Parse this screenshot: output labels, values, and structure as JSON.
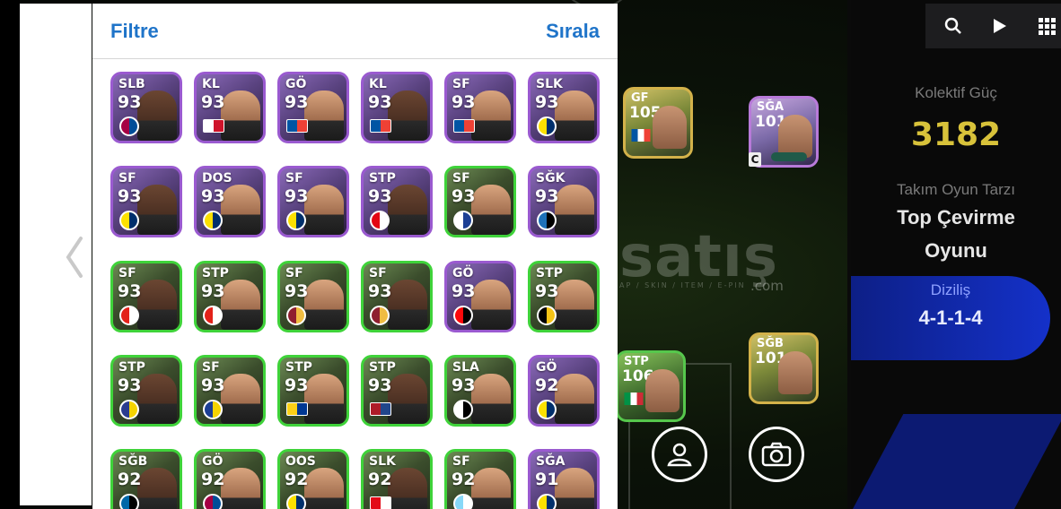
{
  "modal": {
    "filter_label": "Filtre",
    "sort_label": "Sırala"
  },
  "cards": [
    {
      "pos": "SLB",
      "ovr": "93",
      "frame": "purple",
      "emblem": "club-badge",
      "colors": [
        "#a50044",
        "#004d98"
      ]
    },
    {
      "pos": "KL",
      "ovr": "93",
      "frame": "purple",
      "emblem": "flag",
      "colors": [
        "#ffffff",
        "#cf142b"
      ]
    },
    {
      "pos": "GÖ",
      "ovr": "93",
      "frame": "purple",
      "emblem": "flag",
      "colors": [
        "#0055a4",
        "#ef4135"
      ]
    },
    {
      "pos": "KL",
      "ovr": "93",
      "frame": "purple",
      "emblem": "flag",
      "colors": [
        "#0055a4",
        "#ef4135"
      ]
    },
    {
      "pos": "SF",
      "ovr": "93",
      "frame": "purple",
      "emblem": "flag",
      "colors": [
        "#0055a4",
        "#ef4135"
      ]
    },
    {
      "pos": "SLK",
      "ovr": "93",
      "frame": "purple",
      "emblem": "club-badge",
      "colors": [
        "#fde100",
        "#002f6c"
      ]
    },
    {
      "pos": "SF",
      "ovr": "93",
      "frame": "purple",
      "emblem": "club-badge",
      "colors": [
        "#fde100",
        "#002f6c"
      ]
    },
    {
      "pos": "DOS",
      "ovr": "93",
      "frame": "purple",
      "emblem": "club-badge",
      "colors": [
        "#fde100",
        "#002f6c"
      ]
    },
    {
      "pos": "SF",
      "ovr": "93",
      "frame": "purple",
      "emblem": "club-badge",
      "colors": [
        "#fde100",
        "#002f6c"
      ]
    },
    {
      "pos": "STP",
      "ovr": "93",
      "frame": "purple",
      "emblem": "club-badge",
      "colors": [
        "#e30613",
        "#ffffff"
      ]
    },
    {
      "pos": "SF",
      "ovr": "93",
      "frame": "green",
      "emblem": "club-badge",
      "colors": [
        "#ffffff",
        "#1c3f94"
      ]
    },
    {
      "pos": "SĞK",
      "ovr": "93",
      "frame": "purple",
      "emblem": "club-badge",
      "colors": [
        "#1e71b8",
        "#000000"
      ]
    },
    {
      "pos": "SF",
      "ovr": "93",
      "frame": "green",
      "emblem": "club-badge",
      "colors": [
        "#e32219",
        "#ffffff"
      ]
    },
    {
      "pos": "STP",
      "ovr": "93",
      "frame": "green",
      "emblem": "club-badge",
      "colors": [
        "#e32219",
        "#ffffff"
      ]
    },
    {
      "pos": "SF",
      "ovr": "93",
      "frame": "green",
      "emblem": "club-badge",
      "colors": [
        "#8e1f2f",
        "#f0bc42"
      ]
    },
    {
      "pos": "SF",
      "ovr": "93",
      "frame": "green",
      "emblem": "club-badge",
      "colors": [
        "#8e1f2f",
        "#f0bc42"
      ]
    },
    {
      "pos": "GÖ",
      "ovr": "93",
      "frame": "purple",
      "emblem": "club-badge",
      "colors": [
        "#fb090b",
        "#000000"
      ]
    },
    {
      "pos": "STP",
      "ovr": "93",
      "frame": "green",
      "emblem": "club-badge",
      "colors": [
        "#000000",
        "#f3c316"
      ]
    },
    {
      "pos": "STP",
      "ovr": "93",
      "frame": "green",
      "emblem": "club-badge",
      "colors": [
        "#2a3c8f",
        "#f5d400"
      ]
    },
    {
      "pos": "SF",
      "ovr": "93",
      "frame": "green",
      "emblem": "club-badge",
      "colors": [
        "#1c3f94",
        "#f5d400"
      ]
    },
    {
      "pos": "STP",
      "ovr": "93",
      "frame": "green",
      "emblem": "flag",
      "colors": [
        "#fcd116",
        "#003893"
      ]
    },
    {
      "pos": "STP",
      "ovr": "93",
      "frame": "green",
      "emblem": "flag",
      "colors": [
        "#ae1c28",
        "#21468b"
      ]
    },
    {
      "pos": "SLA",
      "ovr": "93",
      "frame": "green",
      "emblem": "club-badge",
      "colors": [
        "#ffffff",
        "#000000"
      ]
    },
    {
      "pos": "GÖ",
      "ovr": "92",
      "frame": "purple",
      "emblem": "club-badge",
      "colors": [
        "#fde100",
        "#002f6c"
      ]
    },
    {
      "pos": "SĞB",
      "ovr": "92",
      "frame": "green",
      "emblem": "club-badge",
      "colors": [
        "#0068a8",
        "#000000"
      ]
    },
    {
      "pos": "GÖ",
      "ovr": "92",
      "frame": "green",
      "emblem": "club-badge",
      "colors": [
        "#a50044",
        "#004d98"
      ]
    },
    {
      "pos": "OOS",
      "ovr": "92",
      "frame": "green",
      "emblem": "club-badge",
      "colors": [
        "#fde100",
        "#002f6c"
      ]
    },
    {
      "pos": "SLK",
      "ovr": "92",
      "frame": "green",
      "emblem": "flag",
      "colors": [
        "#e30a17",
        "#ffffff"
      ]
    },
    {
      "pos": "SF",
      "ovr": "92",
      "frame": "green",
      "emblem": "club-badge",
      "colors": [
        "#87d8f7",
        "#ffffff"
      ]
    },
    {
      "pos": "SĞA",
      "ovr": "91",
      "frame": "purple",
      "emblem": "club-badge",
      "colors": [
        "#fde100",
        "#002f6c"
      ]
    }
  ],
  "field_cards": [
    {
      "pos": "GF",
      "ovr": "105",
      "frame": "gold"
    },
    {
      "pos": "SĞA",
      "ovr": "101",
      "frame": "purple"
    },
    {
      "pos": "STP",
      "ovr": "106",
      "frame": "green"
    },
    {
      "pos": "SĞB",
      "ovr": "101",
      "frame": "gold"
    }
  ],
  "field_card_badge": "C",
  "watermark": {
    "text": "satış",
    "sub": "AP / SKIN / ITEM / E-PIN",
    "domain": ".com"
  },
  "team": {
    "power_label": "Kolektif Güç",
    "power_value": "3182",
    "style_label": "Takım Oyun Tarzı",
    "style_value_line1": "Top Çevirme",
    "style_value_line2": "Oyunu",
    "formation_label": "Diziliş",
    "formation_value": "4-1-1-4"
  },
  "icons": [
    "search-icon",
    "play-icon",
    "grid-icon",
    "chevron-left-icon",
    "person-icon",
    "camera-icon"
  ],
  "colors": {
    "accent": "#1f74c9",
    "power": "#d8c23a",
    "purple_frame": "#9a5ad0",
    "green_frame": "#3fd33a",
    "formation_bg": "#1431c9"
  }
}
